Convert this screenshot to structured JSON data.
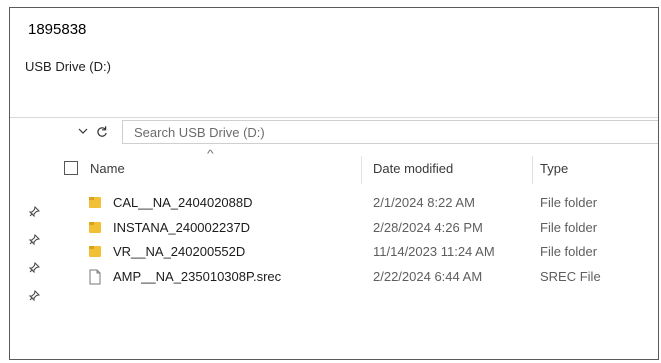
{
  "id_label": "1895838",
  "window": {
    "title": "USB Drive (D:)"
  },
  "nav": {
    "search_placeholder": "Search USB Drive (D:)"
  },
  "columns": {
    "name": "Name",
    "date": "Date modified",
    "type": "Type"
  },
  "files": [
    {
      "name": "CAL__NA_240402088D",
      "date": "2/1/2024 8:22 AM",
      "type": "File folder",
      "icon": "folder-icon"
    },
    {
      "name": "INSTANA_240002237D",
      "date": "2/28/2024 4:26 PM",
      "type": "File folder",
      "icon": "folder-icon"
    },
    {
      "name": "VR__NA_240200552D",
      "date": "11/14/2023 11:24 AM",
      "type": "File folder",
      "icon": "folder-icon"
    },
    {
      "name": "AMP__NA_235010308P.srec",
      "date": "2/22/2024 6:44 AM",
      "type": "SREC File",
      "icon": "file-icon"
    }
  ],
  "colors": {
    "folder": "#f2c037",
    "folder_dark": "#d9a21b",
    "border": "#5a5a5a"
  }
}
